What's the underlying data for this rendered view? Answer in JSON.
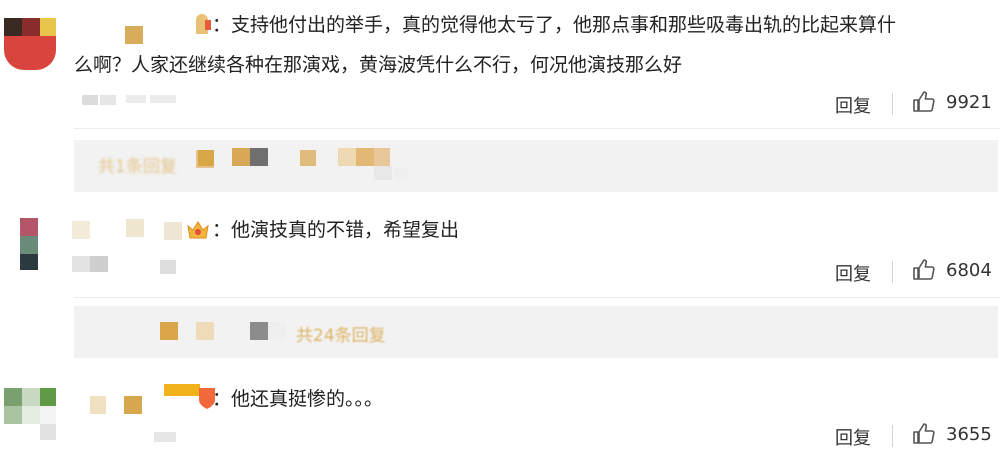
{
  "comments": [
    {
      "text_line1": "：支持他付出的举手，真的觉得他太亏了，他那点事和那些吸毒出轨的比起来算什",
      "text_line2": "么啊？人家还继续各种在那演戏，黄海波凭什么不行，何况他演技那么好",
      "reply_label": "回复",
      "likes": "9921",
      "subreply_text": "共1条回复"
    },
    {
      "text_line1": "：他演技真的不错，希望复出",
      "reply_label": "回复",
      "likes": "6804",
      "subreply_text": "共24条回复"
    },
    {
      "text_line1": "：他还真挺惨的。。。",
      "reply_label": "回复",
      "likes": "3655"
    }
  ],
  "colors": {
    "accent": "#d9a441",
    "mosaic_gold": "#e0b25a",
    "mosaic_gray": "#8a8a8a",
    "subbox_bg": "#f2f2f2"
  },
  "icons": [
    "thumbs-up-icon",
    "crown-badge-icon",
    "vip-badge-icon"
  ]
}
